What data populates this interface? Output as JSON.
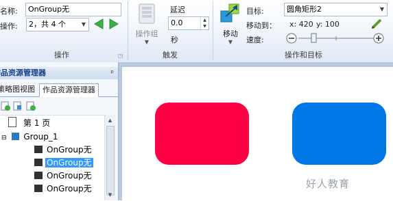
{
  "ribbon": {
    "name_label": "名称:",
    "name_value": "OnGroup无",
    "op_label": "操作:",
    "op_value": "2，共 4 个",
    "group1_title": "操作",
    "actiongroup_label": "操作组",
    "delay_label": "延迟",
    "delay_value": "0.0",
    "seconds_label": "秒",
    "group2_title": "触发",
    "move_label": "移动",
    "target_label": "目标:",
    "target_value": "圆角矩形2",
    "moveto_label": "移动到：",
    "x_label": "x: 420",
    "y_label": "y: 100",
    "speed_label": "速度:",
    "group3_title": "操作和目标"
  },
  "panel": {
    "title": "作品资源管理器",
    "pin": "ᵖ",
    "tab1": "策略图视图",
    "tab2": "作品资源管理器",
    "tree": {
      "page": "第 1 页",
      "group": "Group_1",
      "items": [
        "OnGroup无",
        "OnGroup无",
        "OnGroup无",
        "OnGroup无"
      ]
    }
  },
  "canvas": {
    "shape1_color": "#ff0044",
    "shape2_color": "#0077e6",
    "watermark": "好人教育"
  }
}
